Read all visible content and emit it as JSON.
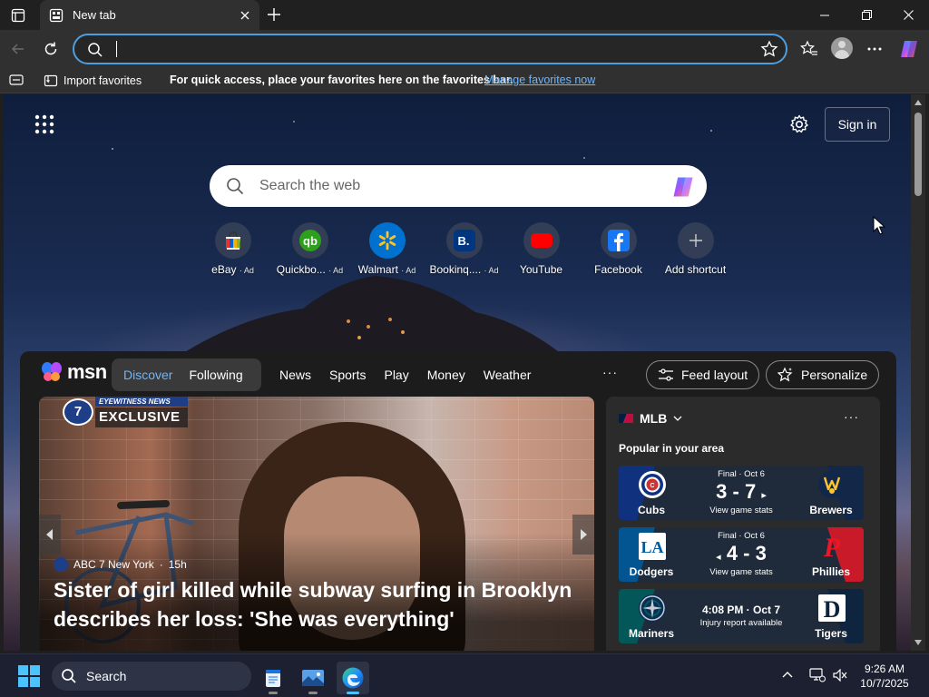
{
  "tab": {
    "title": "New tab"
  },
  "address_bar": {
    "value": "",
    "placeholder": ""
  },
  "favorites_bar": {
    "import_label": "Import favorites",
    "hint": "For quick access, place your favorites here on the favorites bar.",
    "manage_link": "Manage favorites now"
  },
  "page": {
    "signin_label": "Sign in",
    "search_placeholder": "Search the web",
    "shortcuts": [
      {
        "label": "eBay",
        "ad": "· Ad",
        "icon": "ebay-icon"
      },
      {
        "label": "Quickbo...",
        "ad": "· Ad",
        "icon": "quickbooks-icon"
      },
      {
        "label": "Walmart",
        "ad": "· Ad",
        "icon": "walmart-icon"
      },
      {
        "label": "Bookinq....",
        "ad": "· Ad",
        "icon": "booking-icon"
      },
      {
        "label": "YouTube",
        "ad": "",
        "icon": "youtube-icon"
      },
      {
        "label": "Facebook",
        "ad": "",
        "icon": "facebook-icon"
      },
      {
        "label": "Add shortcut",
        "ad": "",
        "icon": "plus-icon"
      }
    ]
  },
  "feed": {
    "logo_text": "msn",
    "pills": [
      "Discover",
      "Following"
    ],
    "nav": [
      "News",
      "Sports",
      "Play",
      "Money",
      "Weather"
    ],
    "more": "···",
    "feed_layout_label": "Feed layout",
    "personalize_label": "Personalize",
    "hero": {
      "badge_top": "EYEWITNESS NEWS",
      "badge_bottom": "EXCLUSIVE",
      "badge_logo": "7",
      "source": "ABC 7 New York",
      "age": "15h",
      "headline": "Sister of girl killed while subway surfing in Brooklyn describes her loss: 'She was everything'"
    },
    "mlb": {
      "title": "MLB",
      "more": "···",
      "subtitle": "Popular in your area",
      "games": [
        {
          "home": "Cubs",
          "away": "Brewers",
          "status": "Final · Oct 6",
          "score": "3 - 7",
          "link": "View game stats",
          "home_color": "#0e3386",
          "away_color": "#12284b"
        },
        {
          "home": "Dodgers",
          "away": "Phillies",
          "status": "Final · Oct 6",
          "score": "4 - 3",
          "link": "View game stats",
          "home_color": "#005a9c",
          "away_color": "#e81828"
        },
        {
          "home": "Mariners",
          "away": "Tigers",
          "time": "4:08 PM · Oct 7",
          "info": "Injury report available",
          "home_color": "#0c2c56",
          "away_color": "#0c2340"
        }
      ]
    }
  },
  "taskbar": {
    "search_label": "Search",
    "time": "9:26 AM",
    "date": "10/7/2025"
  },
  "colors": {
    "accent": "#4c9ee0",
    "link": "#6cb6ff",
    "windows_blue": "#4cc2ff"
  }
}
